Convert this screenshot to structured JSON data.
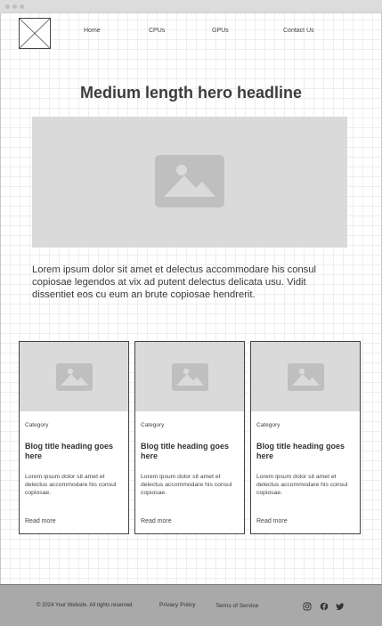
{
  "nav": {
    "items": [
      {
        "label": "Home"
      },
      {
        "label": "CPUs"
      },
      {
        "label": "GPUs"
      },
      {
        "label": "Contact Us"
      }
    ]
  },
  "hero": {
    "title": "Medium length hero headline",
    "text": "Lorem ipsum dolor sit amet et delectus accommodare his consul copiosae legendos at vix ad putent delectus delicata usu. Vidit dissentiet eos cu eum an brute copiosae hendrerit."
  },
  "cards": [
    {
      "category": "Category",
      "title": "Blog title heading goes here",
      "excerpt": "Lorem ipsum dolor sit amet et delectus accommodare his consul copiosae.",
      "read_more": "Read more"
    },
    {
      "category": "Category",
      "title": "Blog title heading goes here",
      "excerpt": "Lorem ipsum dolor sit amet et delectus accommodare his consul copiosae.",
      "read_more": "Read more"
    },
    {
      "category": "Category",
      "title": "Blog title heading goes here",
      "excerpt": "Lorem ipsum dolor sit amet et delectus accommodare his consul copiosae.",
      "read_more": "Read more"
    }
  ],
  "footer": {
    "copyright": "© 2024 Your Website. All rights reserved.",
    "privacy": "Privacy Policy",
    "terms": "Terms of Service",
    "social_icons": [
      "instagram-icon",
      "facebook-icon",
      "twitter-icon"
    ]
  },
  "colors": {
    "placeholder": "#dadada",
    "placeholder_icon": "#bfbfbf",
    "footer_bg": "#a9a9a9",
    "text": "#333333"
  }
}
